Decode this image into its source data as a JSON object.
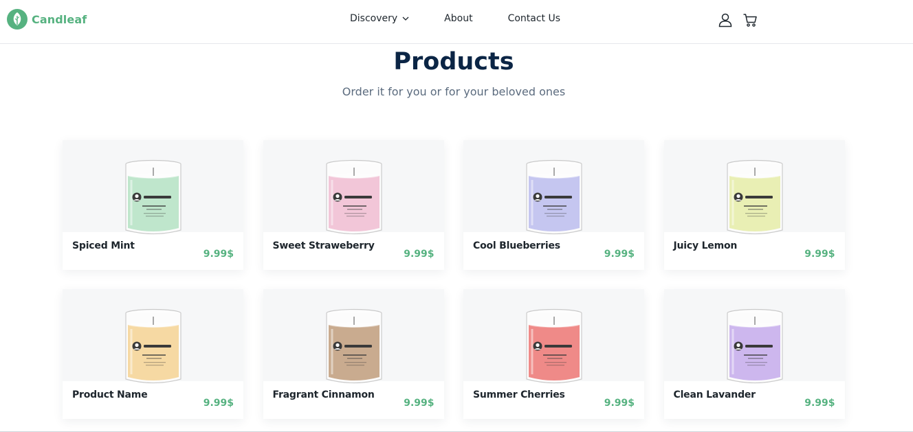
{
  "brand": {
    "name": "Candleaf",
    "color": "#56b280"
  },
  "nav": {
    "discovery": "Discovery",
    "about": "About",
    "contact": "Contact Us"
  },
  "icons": {
    "account": "user-icon",
    "cart": "cart-icon",
    "dropdown": "chevron-down-icon"
  },
  "hero": {
    "title": "Products",
    "subtitle": "Order it for you or for your beloved ones"
  },
  "products": [
    {
      "name": "Spiced Mint",
      "price": "9.99$",
      "color": "#bfe6cc"
    },
    {
      "name": "Sweet Straweberry",
      "price": "9.99$",
      "color": "#f2c6d8"
    },
    {
      "name": "Cool Blueberries",
      "price": "9.99$",
      "color": "#c5c6f0"
    },
    {
      "name": "Juicy Lemon",
      "price": "9.99$",
      "color": "#e9efb4"
    },
    {
      "name": "Product Name",
      "price": "9.99$",
      "color": "#f6d9a3"
    },
    {
      "name": "Fragrant Cinnamon",
      "price": "9.99$",
      "color": "#c9ab8f"
    },
    {
      "name": "Summer Cherries",
      "price": "9.99$",
      "color": "#ef8a88"
    },
    {
      "name": "Clean Lavander",
      "price": "9.99$",
      "color": "#cdb7ee"
    }
  ]
}
